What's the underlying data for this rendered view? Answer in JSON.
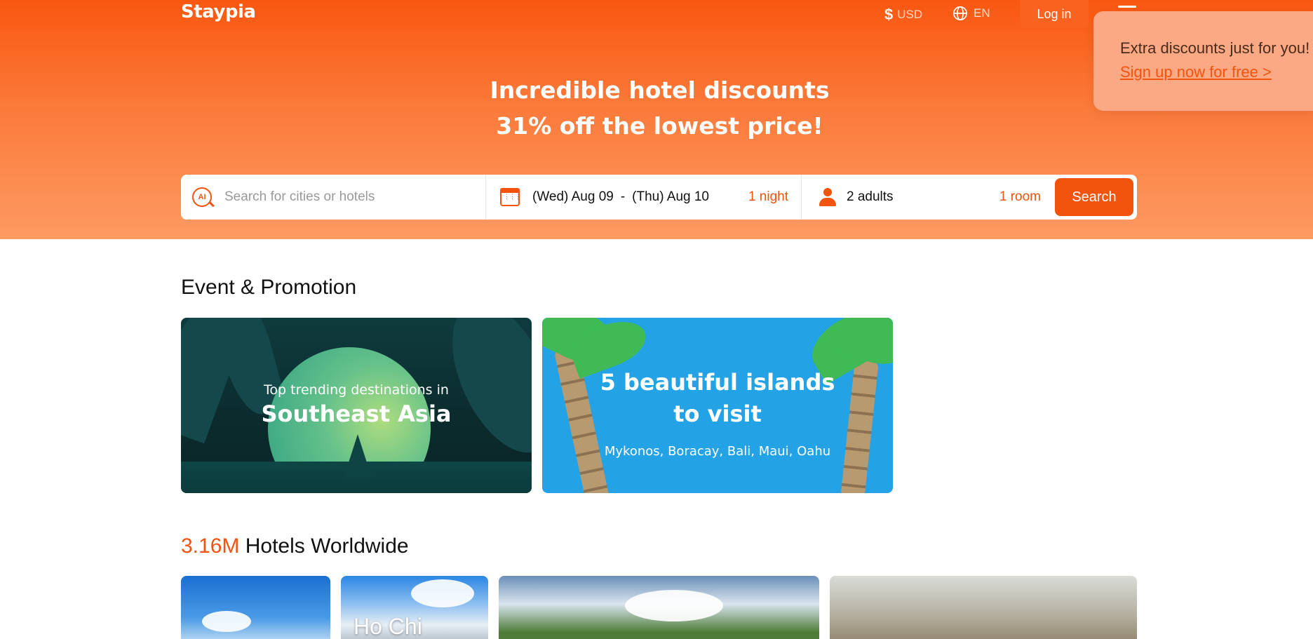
{
  "header": {
    "logo": "Staypia",
    "currency_symbol": "$",
    "currency": "USD",
    "language": "EN",
    "login_label": "Log in"
  },
  "popup": {
    "text": "Extra discounts just for you!",
    "link": "Sign up now for free >"
  },
  "hero": {
    "line1": "Incredible hotel discounts",
    "line2": "31% off the lowest price!"
  },
  "search": {
    "placeholder": "Search for cities or hotels",
    "checkin": "(Wed) Aug 09",
    "separator": "-",
    "checkout": "(Thu) Aug 10",
    "nights": "1 night",
    "adults": "2 adults",
    "rooms": "1 room",
    "button": "Search",
    "ai_icon_text": "AI"
  },
  "promotions": {
    "title": "Event & Promotion",
    "items": [
      {
        "subtitle": "Top trending destinations in",
        "title": "Southeast Asia"
      },
      {
        "title_line1": "5 beautiful islands",
        "title_line2": "to visit",
        "subtitle": "Mykonos, Boracay, Bali, Maui, Oahu"
      }
    ]
  },
  "hotels": {
    "count": "3.16M",
    "title": " Hotels Worldwide",
    "cities": [
      {
        "label": ""
      },
      {
        "label": "Ho Chi"
      },
      {
        "label": ""
      },
      {
        "label": ""
      }
    ]
  },
  "colors": {
    "accent": "#f2530d",
    "hero_top": "#f95710",
    "hero_bottom": "#fd9a62",
    "popup_bg": "#fba985",
    "promo_blue": "#23a3e6"
  }
}
